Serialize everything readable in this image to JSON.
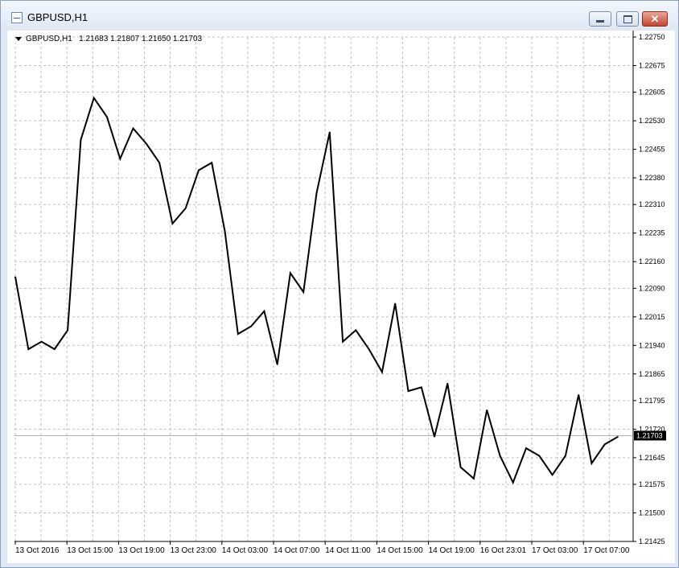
{
  "window": {
    "title": "GBPUSD,H1",
    "info_prefix": "GBPUSD,H1",
    "ohlc": "1.21683 1.21807 1.21650 1.21703",
    "colors": {
      "line": "#000000",
      "grid": "#c0c0c0",
      "price_tag_bg": "#000000",
      "price_tag_text": "#ffffff"
    }
  },
  "chart_data": {
    "type": "line",
    "symbol": "GBPUSD",
    "timeframe": "H1",
    "current_price": 1.21703,
    "ylim": [
      1.21425,
      1.2275
    ],
    "yticks": [
      "1.22750",
      "1.22675",
      "1.22605",
      "1.22530",
      "1.22455",
      "1.22380",
      "1.22310",
      "1.22235",
      "1.22160",
      "1.22090",
      "1.22015",
      "1.21940",
      "1.21865",
      "1.21795",
      "1.21720",
      "1.21645",
      "1.21575",
      "1.21500",
      "1.21425"
    ],
    "xticks": [
      "13 Oct 2016",
      "13 Oct 15:00",
      "13 Oct 19:00",
      "13 Oct 23:00",
      "14 Oct 03:00",
      "14 Oct 07:00",
      "14 Oct 11:00",
      "14 Oct 15:00",
      "14 Oct 19:00",
      "16 Oct 23:01",
      "17 Oct 03:00",
      "17 Oct 07:00"
    ],
    "grid": true,
    "series": [
      {
        "values": [
          1.2212,
          1.2193,
          1.2195,
          1.2193,
          1.2198,
          1.2248,
          1.2259,
          1.2254,
          1.2243,
          1.2251,
          1.2247,
          1.2242,
          1.2226,
          1.223,
          1.224,
          1.2242,
          1.2224,
          1.2197,
          1.2199,
          1.2203,
          1.2189,
          1.2213,
          1.2208,
          1.2234,
          1.225,
          1.2195,
          1.2198,
          1.2193,
          1.2187,
          1.2205,
          1.2182,
          1.2183,
          1.217,
          1.2184,
          1.2162,
          1.2159,
          1.2177,
          1.2165,
          1.2158,
          1.2167,
          1.2165,
          1.216,
          1.2165,
          1.2181,
          1.2163,
          1.2168,
          1.217
        ]
      }
    ]
  }
}
